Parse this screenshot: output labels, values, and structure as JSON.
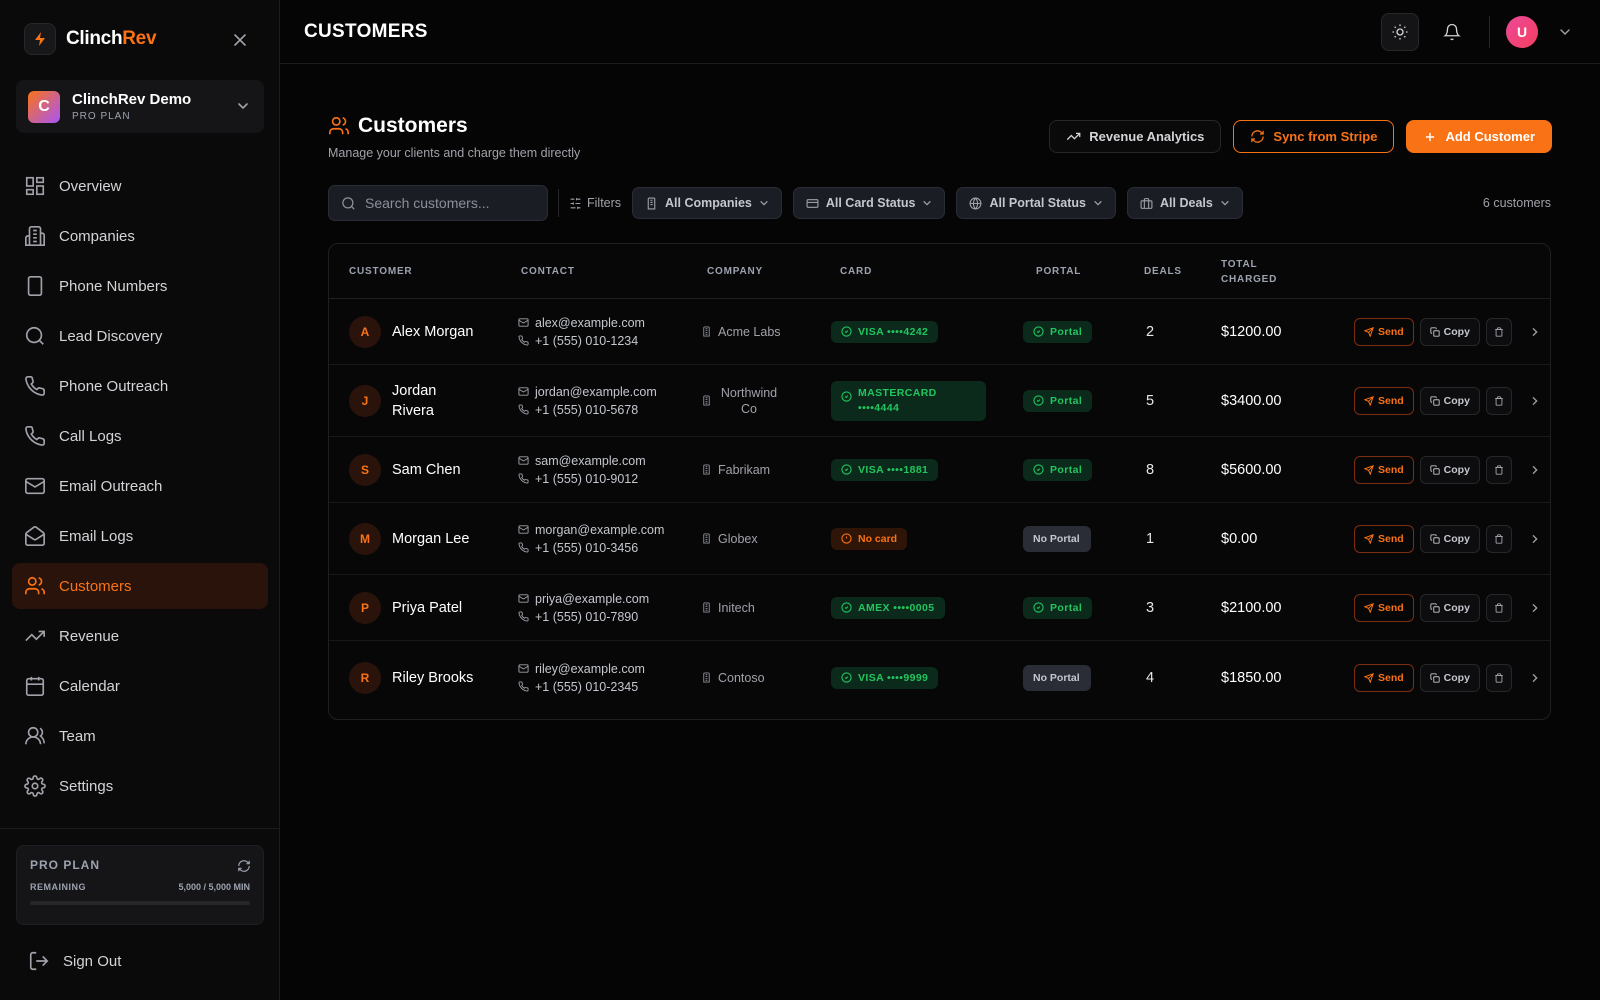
{
  "brand": {
    "name_prefix": "Clinch",
    "name_suffix": "Rev",
    "accent": "#f97316"
  },
  "workspace": {
    "initial": "C",
    "name": "ClinchRev Demo",
    "plan": "PRO PLAN"
  },
  "sidebar": {
    "items": [
      {
        "label": "Overview",
        "icon": "grid-icon"
      },
      {
        "label": "Companies",
        "icon": "building-icon"
      },
      {
        "label": "Phone Numbers",
        "icon": "smartphone-icon"
      },
      {
        "label": "Lead Discovery",
        "icon": "search-icon"
      },
      {
        "label": "Phone Outreach",
        "icon": "phone-icon"
      },
      {
        "label": "Call Logs",
        "icon": "phone-log-icon"
      },
      {
        "label": "Email Outreach",
        "icon": "mail-icon"
      },
      {
        "label": "Email Logs",
        "icon": "mail-open-icon"
      },
      {
        "label": "Customers",
        "icon": "users-icon",
        "active": true
      },
      {
        "label": "Revenue",
        "icon": "trending-up-icon"
      },
      {
        "label": "Calendar",
        "icon": "calendar-icon"
      },
      {
        "label": "Team",
        "icon": "team-icon"
      },
      {
        "label": "Settings",
        "icon": "gear-icon"
      }
    ],
    "plan_card": {
      "title": "PRO PLAN",
      "remaining_label": "REMAINING",
      "remaining_value": "5,000 / 5,000 MIN"
    },
    "sign_out": "Sign Out"
  },
  "topbar": {
    "title": "CUSTOMERS",
    "avatar_initial": "U"
  },
  "page": {
    "title": "Customers",
    "subtitle": "Manage your clients and charge them directly",
    "actions": {
      "analytics": "Revenue Analytics",
      "sync": "Sync from Stripe",
      "add": "Add Customer"
    }
  },
  "filters": {
    "search_placeholder": "Search customers...",
    "filters_label": "Filters",
    "companies": "All Companies",
    "card_status": "All Card Status",
    "portal_status": "All Portal Status",
    "deals": "All Deals",
    "count": "6 customers"
  },
  "table": {
    "headers": {
      "customer": "CUSTOMER",
      "contact": "CONTACT",
      "company": "COMPANY",
      "card": "CARD",
      "portal": "PORTAL",
      "deals": "DEALS",
      "total_1": "TOTAL",
      "total_2": "CHARGED"
    },
    "actions": {
      "send": "Send",
      "copy": "Copy"
    },
    "rows": [
      {
        "initial": "A",
        "name": "Alex Morgan",
        "email": "alex@example.com",
        "phone": "+1 (555) 010-1234",
        "company": "Acme Labs",
        "card": "VISA ••••4242",
        "card_ok": true,
        "portal": "Portal",
        "portal_ok": true,
        "deals": "2",
        "total": "$1200.00"
      },
      {
        "initial": "J",
        "name": "Jordan Rivera",
        "email": "jordan@example.com",
        "phone": "+1 (555) 010-5678",
        "company": "Northwind Co",
        "card": "MASTERCARD ••••4444",
        "card_ok": true,
        "portal": "Portal",
        "portal_ok": true,
        "deals": "5",
        "total": "$3400.00"
      },
      {
        "initial": "S",
        "name": "Sam Chen",
        "email": "sam@example.com",
        "phone": "+1 (555) 010-9012",
        "company": "Fabrikam",
        "card": "VISA ••••1881",
        "card_ok": true,
        "portal": "Portal",
        "portal_ok": true,
        "deals": "8",
        "total": "$5600.00"
      },
      {
        "initial": "M",
        "name": "Morgan Lee",
        "email": "morgan@example.com",
        "phone": "+1 (555) 010-3456",
        "company": "Globex",
        "card": "No card",
        "card_ok": false,
        "portal": "No Portal",
        "portal_ok": false,
        "deals": "1",
        "total": "$0.00"
      },
      {
        "initial": "P",
        "name": "Priya Patel",
        "email": "priya@example.com",
        "phone": "+1 (555) 010-7890",
        "company": "Initech",
        "card": "AMEX ••••0005",
        "card_ok": true,
        "portal": "Portal",
        "portal_ok": true,
        "deals": "3",
        "total": "$2100.00"
      },
      {
        "initial": "R",
        "name": "Riley Brooks",
        "email": "riley@example.com",
        "phone": "+1 (555) 010-2345",
        "company": "Contoso",
        "card": "VISA ••••9999",
        "card_ok": true,
        "portal": "No Portal",
        "portal_ok": false,
        "deals": "4",
        "total": "$1850.00"
      }
    ]
  }
}
